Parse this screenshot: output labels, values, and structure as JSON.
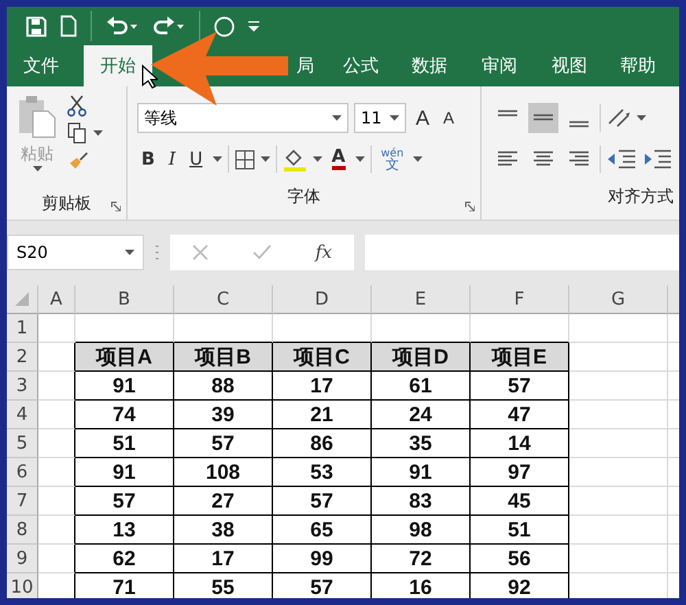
{
  "tabs": [
    {
      "label": "文件",
      "selected": false
    },
    {
      "label": "开始",
      "selected": true
    },
    {
      "label": "局",
      "selected": false
    },
    {
      "label": "公式",
      "selected": false
    },
    {
      "label": "数据",
      "selected": false
    },
    {
      "label": "审阅",
      "selected": false
    },
    {
      "label": "视图",
      "selected": false
    },
    {
      "label": "帮助",
      "selected": false
    }
  ],
  "ribbon": {
    "clipboard": {
      "paste_label": "粘贴",
      "paste_disabled": true,
      "group_label": "剪贴板"
    },
    "font": {
      "font_name": "等线",
      "font_size": "11",
      "grow_font": "A",
      "shrink_font": "A",
      "bold": "B",
      "italic": "I",
      "underline": "U",
      "font_color": "A",
      "phonetic_top": "wén",
      "phonetic_bottom": "文",
      "group_label": "字体"
    },
    "alignment": {
      "vertical": [
        {
          "selected": false
        },
        {
          "selected": true
        },
        {
          "selected": false
        }
      ],
      "group_label": "对齐方式"
    }
  },
  "formula_bar": {
    "name_box": "S20",
    "function_label": "fx"
  },
  "sheet": {
    "columns": [
      "A",
      "B",
      "C",
      "D",
      "E",
      "F",
      "G"
    ],
    "row_numbers": [
      "1",
      "2",
      "3",
      "4",
      "5",
      "6",
      "7",
      "8",
      "9",
      "10"
    ],
    "table": {
      "header": [
        "项目A",
        "项目B",
        "项目C",
        "项目D",
        "项目E"
      ],
      "rows": [
        [
          "91",
          "88",
          "17",
          "61",
          "57"
        ],
        [
          "74",
          "39",
          "21",
          "24",
          "47"
        ],
        [
          "51",
          "57",
          "86",
          "35",
          "14"
        ],
        [
          "91",
          "108",
          "53",
          "91",
          "97"
        ],
        [
          "57",
          "27",
          "57",
          "83",
          "45"
        ],
        [
          "13",
          "38",
          "65",
          "98",
          "51"
        ],
        [
          "62",
          "17",
          "99",
          "72",
          "56"
        ],
        [
          "71",
          "55",
          "57",
          "16",
          "92"
        ]
      ]
    }
  }
}
